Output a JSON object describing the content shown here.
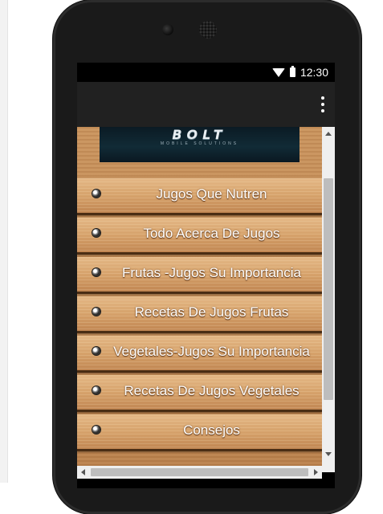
{
  "status_bar": {
    "time": "12:30",
    "icons": [
      "wifi-icon",
      "battery-icon"
    ]
  },
  "app_bar": {
    "overflow_icon": "more-vert-icon"
  },
  "banner": {
    "title": "BOLT",
    "subtitle": "MOBILE SOLUTIONS"
  },
  "menu": {
    "items": [
      {
        "label": "Jugos Que Nutren"
      },
      {
        "label": "Todo Acerca De Jugos"
      },
      {
        "label": "Frutas -Jugos Su Importancia"
      },
      {
        "label": "Recetas De Jugos Frutas"
      },
      {
        "label": "Vegetales-Jugos Su Importancia"
      },
      {
        "label": "Recetas De Jugos Vegetales"
      },
      {
        "label": "Consejos"
      }
    ]
  },
  "colors": {
    "wood": "#cf9a63",
    "appbar": "#212121",
    "statusbar": "#000000",
    "banner": "#0d1f29"
  }
}
